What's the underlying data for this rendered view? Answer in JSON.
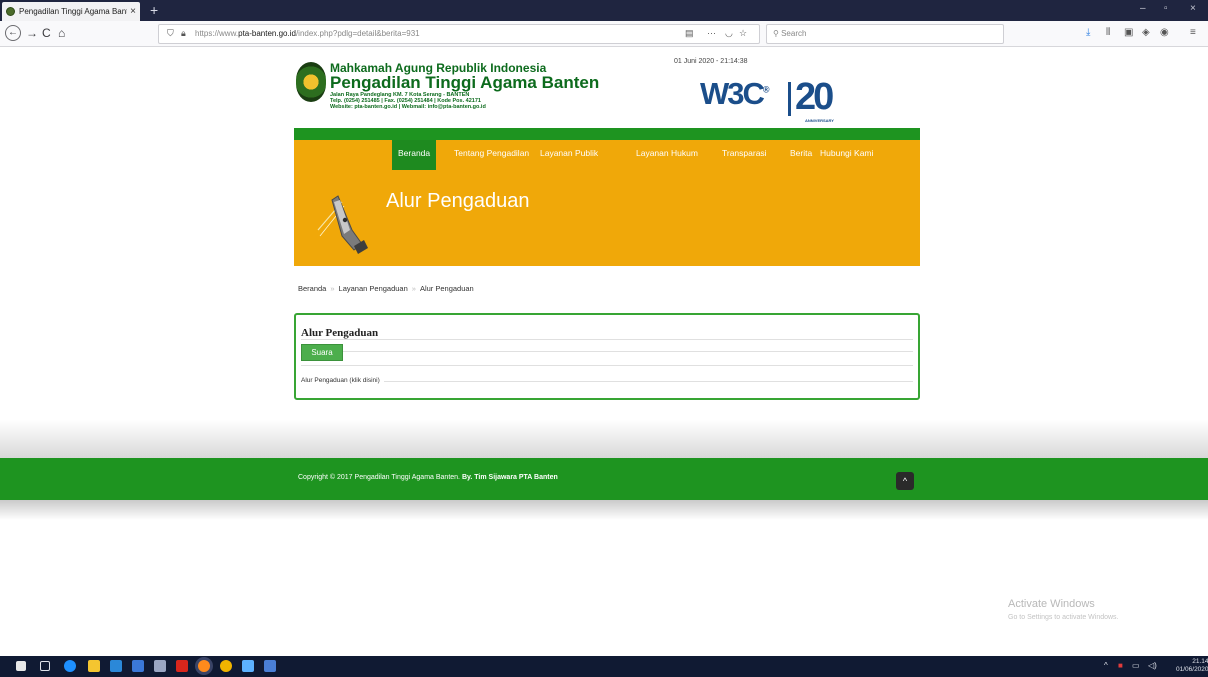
{
  "browser": {
    "tab_title": "Pengadilan Tinggi Agama Bant",
    "tab_close": "×",
    "new_tab": "+",
    "url_prefix": "https://www.",
    "url_domain": "pta-banten.go.id",
    "url_path": "/index.php?pdlg=detail&berita=931",
    "search_placeholder": "Search",
    "window_controls": [
      "–",
      "▫",
      "×"
    ]
  },
  "header": {
    "org_line1": "Mahkamah Agung Republik Indonesia",
    "org_line2": "Pengadilan Tinggi Agama Banten",
    "address1": "Jalan Raya Pandeglang KM. 7 Kota Serang - BANTEN",
    "address2": "Telp. (0254) 251485 | Fax. (0254) 251484 | Kode Pos. 42171",
    "address3": "Website: pta-banten.go.id | Webmail: info@pta-banten.go.id",
    "datetime": "01 Juni 2020 - 21:14:38",
    "w3c_text": "W3C",
    "w3c_reg": "®",
    "w3c_20": "20",
    "w3c_anniv": "ANNIVERSARY"
  },
  "menu": {
    "items": [
      "Beranda",
      "Tentang Pengadilan",
      "Layanan Publik",
      "Layanan Hukum",
      "Transparasi",
      "Berita",
      "Hubungi Kami"
    ],
    "active": "Beranda"
  },
  "banner": {
    "title": "Alur Pengaduan"
  },
  "breadcrumb": {
    "items": [
      "Beranda",
      "Layanan Pengaduan",
      "Alur Pengaduan"
    ],
    "sep": "»"
  },
  "panel": {
    "title": "Alur Pengaduan",
    "suara_label": "Suara",
    "link_text": "Alur Pengaduan (klik disini)"
  },
  "footer": {
    "copyright": "Copyright © 2017 Pengadilan Tinggi Agama Banten.",
    "credit": "By. Tim Sijawara PTA Banten",
    "top_icon": "^"
  },
  "watermark": {
    "line1": "Activate Windows",
    "line2": "Go to Settings to activate Windows."
  },
  "taskbar": {
    "time": "21.14",
    "date": "01/06/2020"
  }
}
